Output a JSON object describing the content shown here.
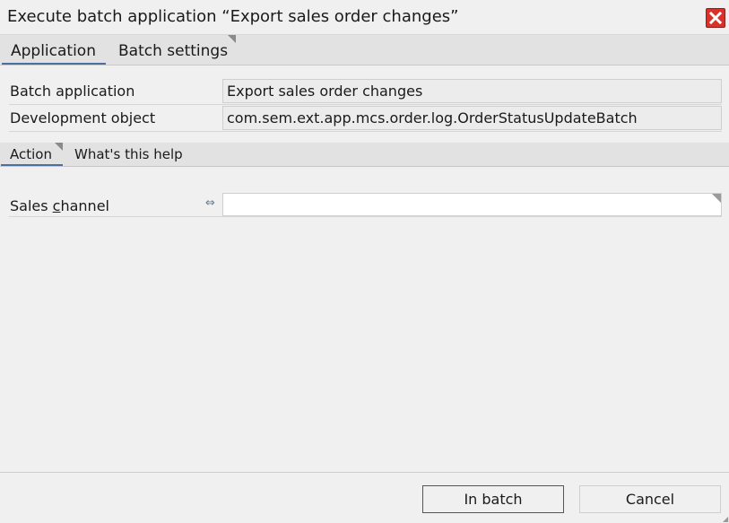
{
  "window": {
    "title": "Execute batch application “Export sales order changes”",
    "close_icon": "close-icon"
  },
  "main_tabs": [
    {
      "label": "Application",
      "active": true
    },
    {
      "label": "Batch settings",
      "active": false
    }
  ],
  "info": {
    "batch_application_label": "Batch application",
    "batch_application_value": "Export sales order changes",
    "development_object_label": "Development object",
    "development_object_value": "com.sem.ext.app.mcs.order.log.OrderStatusUpdateBatch"
  },
  "sub_tabs": [
    {
      "label": "Action",
      "active": true
    },
    {
      "label": "What's this help",
      "active": false
    }
  ],
  "form": {
    "sales_channel_label_pre": "Sales ",
    "sales_channel_label_mnemonic": "c",
    "sales_channel_label_post": "hannel",
    "sales_channel_value": "",
    "link_icon": "⇔"
  },
  "buttons": {
    "in_batch": "In batch",
    "cancel": "Cancel"
  },
  "colors": {
    "accent": "#4a6fa0",
    "close": "#d9322b"
  }
}
